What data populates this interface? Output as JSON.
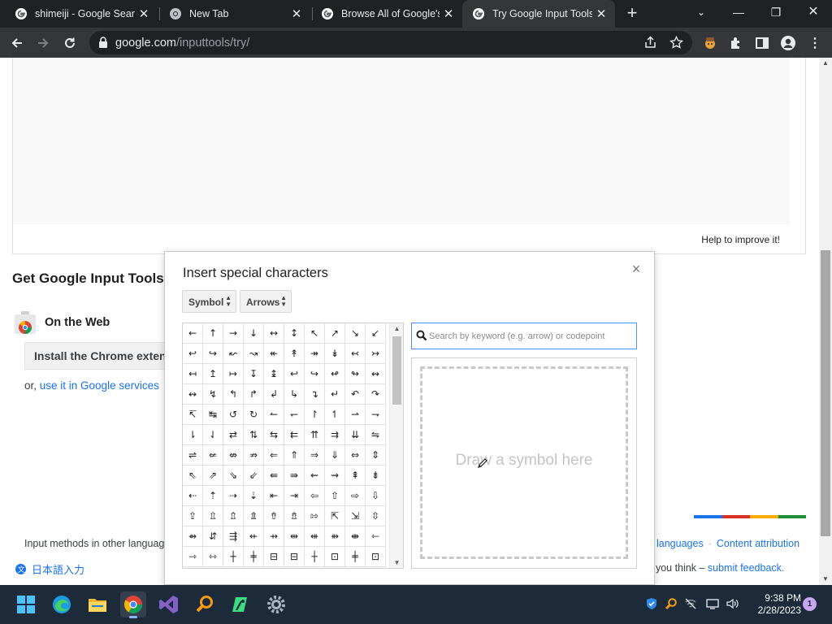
{
  "browser": {
    "tabs": [
      {
        "title": "shimeiji - Google Search",
        "icon": "google-g-icon",
        "active": false
      },
      {
        "title": "New Tab",
        "icon": "chrome-icon",
        "active": false
      },
      {
        "title": "Browse All of Google's Products",
        "icon": "google-g-icon",
        "active": false
      },
      {
        "title": "Try Google Input Tools",
        "icon": "google-g-icon",
        "active": true
      }
    ],
    "address": {
      "domain": "google.com",
      "path": "/inputtools/try/"
    }
  },
  "page": {
    "help_link": "Help to improve it!",
    "section_title": "Get Google Input Tools",
    "on_the_web": "On the Web",
    "install_button": "Install the Chrome extension",
    "or_prefix": "or, ",
    "google_services_link": "use it in Google services",
    "footer_left": "Input methods in other languages",
    "footer_languages": "languages",
    "footer_separator": "·",
    "footer_attribution": "Content attribution",
    "language_selector": "日本語入力",
    "feedback_prefix": "t you think – ",
    "feedback_link": "submit feedback.",
    "color_bar": [
      "#1a73e8",
      "#d93025",
      "#f9ab00",
      "#1e8e3e"
    ]
  },
  "dialog": {
    "title": "Insert special characters",
    "close": "×",
    "category_select": "Symbol",
    "subcategory_select": "Arrows",
    "search_placeholder": "Search by keyword (e.g. arrow) or codepoint",
    "draw_hint": "Draw a symbol here",
    "characters": [
      "←",
      "↑",
      "→",
      "↓",
      "↔",
      "↕",
      "↖",
      "↗",
      "↘",
      "↙",
      "↩",
      "↪",
      "↜",
      "↝",
      "↞",
      "↟",
      "↠",
      "↡",
      "↢",
      "↣",
      "↤",
      "↥",
      "↦",
      "↧",
      "↨",
      "↩",
      "↪",
      "↫",
      "↬",
      "↭",
      "↭",
      "↯",
      "↰",
      "↱",
      "↲",
      "↳",
      "↴",
      "↵",
      "↶",
      "↷",
      "↸",
      "↹",
      "↺",
      "↻",
      "↼",
      "↽",
      "↾",
      "↿",
      "⇀",
      "⇁",
      "⇂",
      "⇃",
      "⇄",
      "⇅",
      "⇆",
      "⇇",
      "⇈",
      "⇉",
      "⇊",
      "⇋",
      "⇌",
      "⇍",
      "⇎",
      "⇏",
      "⇐",
      "⇑",
      "⇒",
      "⇓",
      "⇔",
      "⇕",
      "⇖",
      "⇗",
      "⇘",
      "⇙",
      "⇚",
      "⇛",
      "⇜",
      "⇝",
      "⇞",
      "⇟",
      "⇠",
      "⇡",
      "⇢",
      "⇣",
      "⇤",
      "⇥",
      "⇦",
      "⇧",
      "⇨",
      "⇩",
      "⇪",
      "⇫",
      "⇬",
      "⇭",
      "⇮",
      "⇯",
      "⇰",
      "⇱",
      "⇲",
      "⇳",
      "⇴",
      "⇵",
      "⇶",
      "⇷",
      "⇸",
      "⇹",
      "⇺",
      "⇻",
      "⇼",
      "⇽",
      "⇾",
      "⇿",
      "┼",
      "╪",
      "⊟",
      "⊟",
      "┼",
      "⊡",
      "╪",
      "⊡"
    ]
  },
  "taskbar": {
    "apps": [
      "windows-start-icon",
      "edge-icon",
      "file-explorer-icon",
      "chrome-icon",
      "visual-studio-icon",
      "search-tool-icon",
      "android-studio-icon",
      "settings-icon"
    ],
    "time": "9:38 PM",
    "date": "2/28/2023",
    "notification_count": "1"
  }
}
